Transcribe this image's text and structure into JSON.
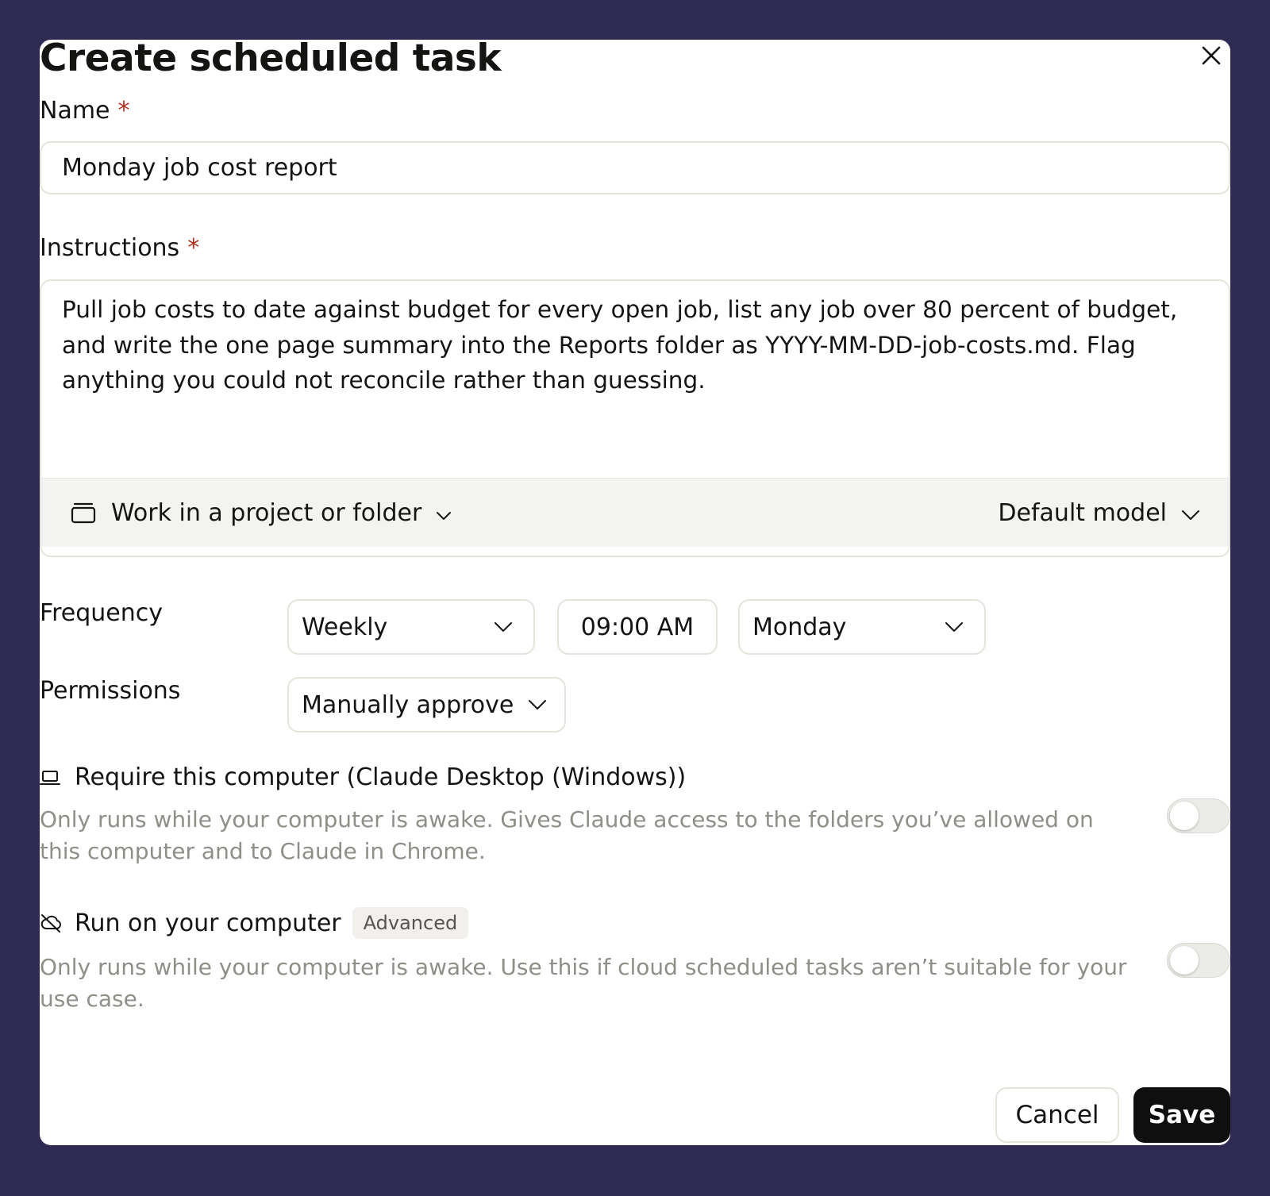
{
  "dialog": {
    "title": "Create scheduled task",
    "close_icon": "close-icon"
  },
  "name_field": {
    "label": "Name",
    "required_marker": "*",
    "value": "Monday job cost report"
  },
  "instructions_field": {
    "label": "Instructions",
    "required_marker": "*",
    "value": "Pull job costs to date against budget for every open job, list any job over 80 percent of budget, and write the one page summary into the Reports folder as YYYY-MM-DD-job-costs.md. Flag anything you could not reconcile rather than guessing."
  },
  "composer_footer": {
    "folder_icon": "folder-icon",
    "folder_label": "Work in a project or folder",
    "model_label": "Default model"
  },
  "frequency": {
    "label": "Frequency",
    "interval": "Weekly",
    "time": "09:00 AM",
    "day": "Monday"
  },
  "permissions": {
    "label": "Permissions",
    "value": "Manually approve"
  },
  "options": [
    {
      "icon": "laptop-icon",
      "title": "Require this computer (Claude Desktop (Windows))",
      "description": "Only runs while your computer is awake. Gives Claude access to the folders you’ve allowed on this computer and to Claude in Chrome.",
      "enabled": false
    },
    {
      "icon": "cloud-off-icon",
      "title": "Run on your computer",
      "badge": "Advanced",
      "description": "Only runs while your computer is awake. Use this if cloud scheduled tasks aren’t suitable for your use case.",
      "enabled": false
    }
  ],
  "actions": {
    "cancel_label": "Cancel",
    "save_label": "Save"
  },
  "colors": {
    "backdrop": "#2e2a52",
    "required": "#b0301e",
    "primary_button": "#0f0f0f",
    "muted_text": "#8f8e88"
  }
}
